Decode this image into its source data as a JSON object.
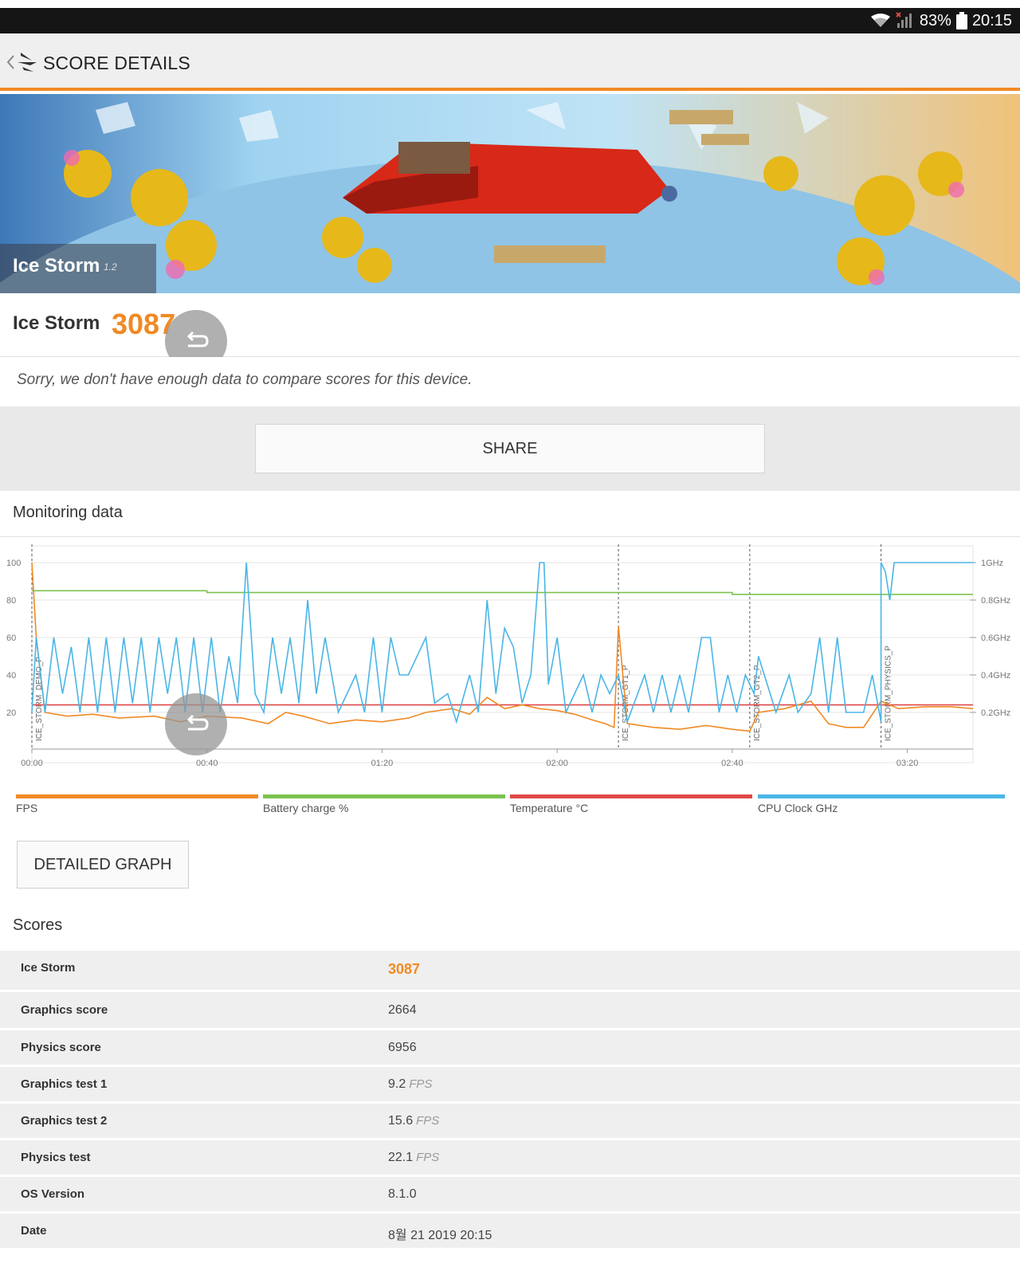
{
  "status_bar": {
    "battery": "83%",
    "time": "20:15"
  },
  "app_bar": {
    "title": "SCORE DETAILS"
  },
  "banner": {
    "title": "Ice Storm",
    "version": "1.2"
  },
  "score": {
    "name": "Ice Storm",
    "value": "3087"
  },
  "compare_message": "Sorry, we don't have enough data to compare scores for this device.",
  "share_label": "SHARE",
  "monitoring": {
    "title": "Monitoring data",
    "legend": [
      "FPS",
      "Battery charge %",
      "Temperature °C",
      "CPU Clock GHz"
    ],
    "legend_colors": [
      "#f08a24",
      "#7cc24e",
      "#e04848",
      "#4ab5e6"
    ],
    "detailed_graph_label": "DETAILED GRAPH"
  },
  "chart_data": {
    "type": "line",
    "x_ticks": [
      "00:00",
      "00:40",
      "01:20",
      "02:00",
      "02:40",
      "03:20"
    ],
    "x_range_seconds": [
      0,
      215
    ],
    "y_left_ticks": [
      "100",
      "80",
      "60",
      "40",
      "20"
    ],
    "y_left_range": [
      0,
      100
    ],
    "y_right_ticks": [
      "1GHz",
      "0.8GHz",
      "0.6GHz",
      "0.4GHz",
      "0.2GHz"
    ],
    "y_right_range": [
      0,
      1
    ],
    "markers": [
      {
        "label": "ICE_STORM_DEMO_P",
        "t": 0
      },
      {
        "label": "ICE_STORM_GT1_P",
        "t": 134
      },
      {
        "label": "ICE_STORM_GT2_P",
        "t": 164
      },
      {
        "label": "ICE_STORM_PHYSICS_P",
        "t": 194
      }
    ],
    "series": [
      {
        "name": "Battery charge %",
        "axis": "left",
        "points": [
          [
            0,
            85
          ],
          [
            40,
            85
          ],
          [
            40,
            84
          ],
          [
            160,
            84
          ],
          [
            160,
            83
          ],
          [
            215,
            83
          ]
        ]
      },
      {
        "name": "Temperature °C",
        "axis": "left",
        "points": [
          [
            0,
            24
          ],
          [
            215,
            24
          ]
        ]
      },
      {
        "name": "FPS",
        "axis": "left",
        "points": [
          [
            0,
            100
          ],
          [
            1,
            60
          ],
          [
            3,
            20
          ],
          [
            8,
            18
          ],
          [
            14,
            19
          ],
          [
            20,
            17
          ],
          [
            28,
            18
          ],
          [
            34,
            15
          ],
          [
            40,
            18
          ],
          [
            48,
            17
          ],
          [
            54,
            14
          ],
          [
            58,
            20
          ],
          [
            62,
            18
          ],
          [
            68,
            14
          ],
          [
            74,
            16
          ],
          [
            80,
            15
          ],
          [
            86,
            17
          ],
          [
            90,
            20
          ],
          [
            96,
            22
          ],
          [
            100,
            19
          ],
          [
            104,
            28
          ],
          [
            108,
            22
          ],
          [
            112,
            24
          ],
          [
            116,
            22
          ],
          [
            120,
            21
          ],
          [
            124,
            19
          ],
          [
            128,
            16
          ],
          [
            131,
            14
          ],
          [
            133,
            12
          ],
          [
            134,
            66
          ],
          [
            136,
            14
          ],
          [
            142,
            12
          ],
          [
            148,
            11
          ],
          [
            154,
            13
          ],
          [
            160,
            11
          ],
          [
            164,
            10
          ],
          [
            166,
            20
          ],
          [
            172,
            22
          ],
          [
            178,
            26
          ],
          [
            182,
            14
          ],
          [
            186,
            12
          ],
          [
            190,
            12
          ],
          [
            194,
            26
          ],
          [
            198,
            22
          ],
          [
            204,
            23
          ],
          [
            210,
            23
          ],
          [
            215,
            22
          ]
        ]
      },
      {
        "name": "CPU Clock GHz",
        "axis": "right",
        "points": [
          [
            0,
            0.2
          ],
          [
            1,
            0.6
          ],
          [
            3,
            0.2
          ],
          [
            5,
            0.6
          ],
          [
            7,
            0.3
          ],
          [
            9,
            0.55
          ],
          [
            11,
            0.2
          ],
          [
            13,
            0.6
          ],
          [
            15,
            0.2
          ],
          [
            17,
            0.6
          ],
          [
            19,
            0.2
          ],
          [
            21,
            0.6
          ],
          [
            23,
            0.25
          ],
          [
            25,
            0.6
          ],
          [
            27,
            0.2
          ],
          [
            29,
            0.6
          ],
          [
            31,
            0.3
          ],
          [
            33,
            0.6
          ],
          [
            35,
            0.2
          ],
          [
            37,
            0.6
          ],
          [
            39,
            0.2
          ],
          [
            41,
            0.6
          ],
          [
            43,
            0.2
          ],
          [
            45,
            0.5
          ],
          [
            47,
            0.25
          ],
          [
            49,
            1.0
          ],
          [
            51,
            0.3
          ],
          [
            53,
            0.2
          ],
          [
            55,
            0.6
          ],
          [
            57,
            0.3
          ],
          [
            59,
            0.6
          ],
          [
            61,
            0.25
          ],
          [
            63,
            0.8
          ],
          [
            65,
            0.3
          ],
          [
            67,
            0.6
          ],
          [
            70,
            0.2
          ],
          [
            74,
            0.4
          ],
          [
            76,
            0.2
          ],
          [
            78,
            0.6
          ],
          [
            80,
            0.2
          ],
          [
            82,
            0.6
          ],
          [
            84,
            0.4
          ],
          [
            86,
            0.4
          ],
          [
            90,
            0.6
          ],
          [
            92,
            0.25
          ],
          [
            95,
            0.3
          ],
          [
            97,
            0.15
          ],
          [
            100,
            0.4
          ],
          [
            102,
            0.2
          ],
          [
            104,
            0.8
          ],
          [
            106,
            0.3
          ],
          [
            108,
            0.65
          ],
          [
            110,
            0.55
          ],
          [
            112,
            0.25
          ],
          [
            114,
            0.4
          ],
          [
            116,
            1.0
          ],
          [
            117,
            1.0
          ],
          [
            118,
            0.35
          ],
          [
            120,
            0.6
          ],
          [
            122,
            0.2
          ],
          [
            124,
            0.3
          ],
          [
            126,
            0.4
          ],
          [
            128,
            0.2
          ],
          [
            130,
            0.4
          ],
          [
            132,
            0.3
          ],
          [
            134,
            0.4
          ],
          [
            136,
            0.15
          ],
          [
            140,
            0.4
          ],
          [
            142,
            0.2
          ],
          [
            144,
            0.4
          ],
          [
            146,
            0.2
          ],
          [
            148,
            0.4
          ],
          [
            150,
            0.2
          ],
          [
            153,
            0.6
          ],
          [
            155,
            0.6
          ],
          [
            157,
            0.2
          ],
          [
            159,
            0.4
          ],
          [
            161,
            0.2
          ],
          [
            163,
            0.4
          ],
          [
            165,
            0.3
          ],
          [
            166,
            0.5
          ],
          [
            170,
            0.2
          ],
          [
            173,
            0.4
          ],
          [
            175,
            0.2
          ],
          [
            178,
            0.3
          ],
          [
            180,
            0.6
          ],
          [
            182,
            0.2
          ],
          [
            184,
            0.6
          ],
          [
            186,
            0.2
          ],
          [
            190,
            0.2
          ],
          [
            192,
            0.4
          ],
          [
            194,
            0.15
          ],
          [
            194,
            1.0
          ],
          [
            195,
            0.95
          ],
          [
            196,
            0.8
          ],
          [
            197,
            1.0
          ],
          [
            215,
            1.0
          ]
        ]
      }
    ]
  },
  "scores": {
    "title": "Scores",
    "rows": [
      {
        "name": "Ice Storm",
        "value": "3087",
        "unit": "",
        "highlight": true
      },
      {
        "name": "Graphics score",
        "value": "2664",
        "unit": ""
      },
      {
        "name": "Physics score",
        "value": "6956",
        "unit": ""
      },
      {
        "name": "Graphics test 1",
        "value": "9.2",
        "unit": "FPS"
      },
      {
        "name": "Graphics test 2",
        "value": "15.6",
        "unit": "FPS"
      },
      {
        "name": "Physics test",
        "value": "22.1",
        "unit": "FPS"
      },
      {
        "name": "OS Version",
        "value": "8.1.0",
        "unit": ""
      },
      {
        "name": "Date",
        "value": "8월 21 2019 20:15",
        "unit": ""
      }
    ]
  }
}
